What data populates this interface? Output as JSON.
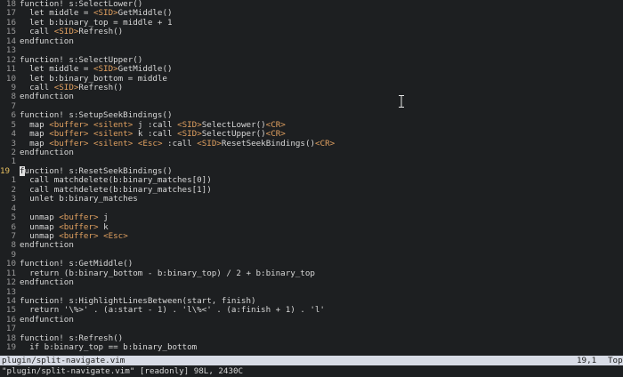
{
  "editor": {
    "lines": [
      {
        "num": "18",
        "text": "function! s:SelectLower()"
      },
      {
        "num": "17",
        "text": "  let middle = <SID>GetMiddle()"
      },
      {
        "num": "16",
        "text": "  let b:binary_top = middle + 1"
      },
      {
        "num": "15",
        "text": "  call <SID>Refresh()"
      },
      {
        "num": "14",
        "text": "endfunction"
      },
      {
        "num": "13",
        "text": ""
      },
      {
        "num": "12",
        "text": "function! s:SelectUpper()"
      },
      {
        "num": "11",
        "text": "  let middle = <SID>GetMiddle()"
      },
      {
        "num": "10",
        "text": "  let b:binary_bottom = middle"
      },
      {
        "num": "9",
        "text": "  call <SID>Refresh()"
      },
      {
        "num": "8",
        "text": "endfunction"
      },
      {
        "num": "7",
        "text": ""
      },
      {
        "num": "6",
        "text": "function! s:SetupSeekBindings()"
      },
      {
        "num": "5",
        "text": "  map <buffer> <silent> j :call <SID>SelectLower()<CR>"
      },
      {
        "num": "4",
        "text": "  map <buffer> <silent> k :call <SID>SelectUpper()<CR>"
      },
      {
        "num": "3",
        "text": "  map <buffer> <silent> <Esc> :call <SID>ResetSeekBindings()<CR>"
      },
      {
        "num": "2",
        "text": "endfunction"
      },
      {
        "num": "1",
        "text": ""
      },
      {
        "num": "19",
        "text": "unction! s:ResetSeekBindings()",
        "current": true,
        "cursor_char": "f"
      },
      {
        "num": "1",
        "text": "  call matchdelete(b:binary_matches[0])"
      },
      {
        "num": "2",
        "text": "  call matchdelete(b:binary_matches[1])"
      },
      {
        "num": "3",
        "text": "  unlet b:binary_matches"
      },
      {
        "num": "4",
        "text": ""
      },
      {
        "num": "5",
        "text": "  unmap <buffer> j"
      },
      {
        "num": "6",
        "text": "  unmap <buffer> k"
      },
      {
        "num": "7",
        "text": "  unmap <buffer> <Esc>"
      },
      {
        "num": "8",
        "text": "endfunction"
      },
      {
        "num": "9",
        "text": ""
      },
      {
        "num": "10",
        "text": "function! s:GetMiddle()"
      },
      {
        "num": "11",
        "text": "  return (b:binary_bottom - b:binary_top) / 2 + b:binary_top"
      },
      {
        "num": "12",
        "text": "endfunction"
      },
      {
        "num": "13",
        "text": ""
      },
      {
        "num": "14",
        "text": "function! s:HighlightLinesBetween(start, finish)"
      },
      {
        "num": "15",
        "text": "  return '\\%>' . (a:start - 1) . 'l\\%<' . (a:finish + 1) . 'l'"
      },
      {
        "num": "16",
        "text": "endfunction"
      },
      {
        "num": "17",
        "text": ""
      },
      {
        "num": "18",
        "text": "function! s:Refresh()"
      },
      {
        "num": "19",
        "text": "  if b:binary_top == b:binary_bottom"
      }
    ]
  },
  "statusline": {
    "filename": "plugin/split-navigate.vim",
    "position": "19,1",
    "scroll": "Top"
  },
  "cmdline": {
    "message": "\"plugin/split-navigate.vim\" [readonly] 98L, 2430C"
  },
  "colors": {
    "background": "#1d1f21",
    "statusline_bg": "#d8dce6",
    "current_line_number": "#e8c060"
  }
}
